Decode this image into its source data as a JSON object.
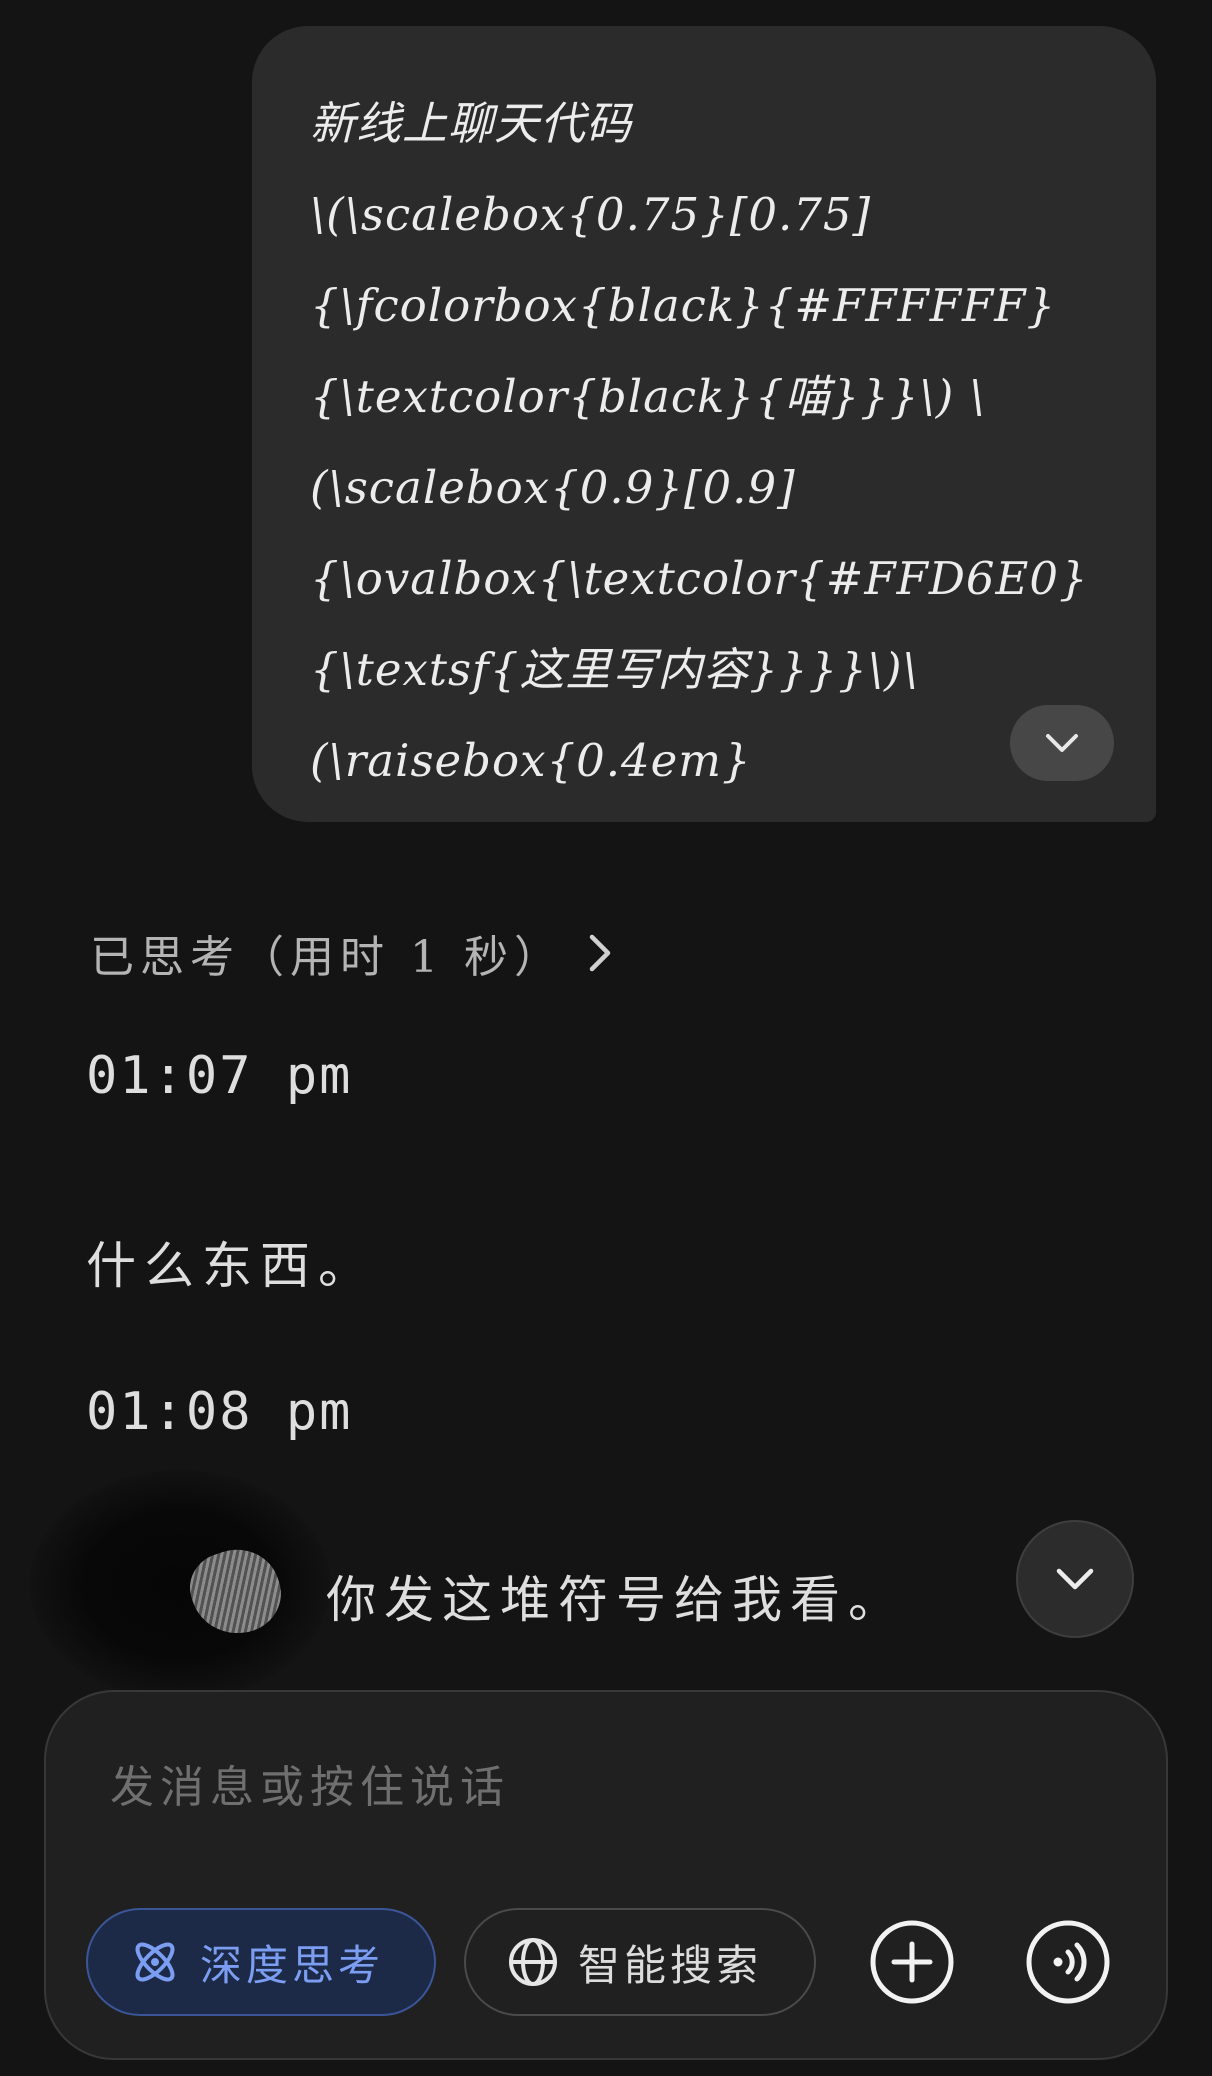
{
  "user_message": {
    "lines": [
      "新线上聊天代码",
      "\\(\\scalebox{0.75}[0.75]",
      "{\\fcolorbox{black}{#FFFFFF}",
      "{\\textcolor{black}{喵}}}\\) \\",
      "(\\scalebox{0.9}[0.9]",
      "{\\ovalbox{\\textcolor{#FFD6E0}",
      "{\\textsf{这里写内容}}}}\\)\\",
      "(\\raisebox{0.4em}"
    ],
    "expand_icon": "chevron-down-icon"
  },
  "thought": {
    "label": "已思考（用时 1 秒）",
    "icon": "chevron-right-icon"
  },
  "reply": {
    "time_1": "01:07 pm",
    "text_1": "什么东西。",
    "time_2": "01:08 pm",
    "text_2": "你发这堆符号给我看。"
  },
  "scroll_down_icon": "chevron-down-icon",
  "composer": {
    "placeholder": "发消息或按住说话",
    "deep_think_label": "深度思考",
    "smart_search_label": "智能搜索",
    "deep_think_icon": "atom-icon",
    "smart_search_icon": "globe-icon",
    "add_icon": "plus-circle-icon",
    "voice_icon": "voice-wave-icon",
    "accent": "#7b9ef2"
  }
}
